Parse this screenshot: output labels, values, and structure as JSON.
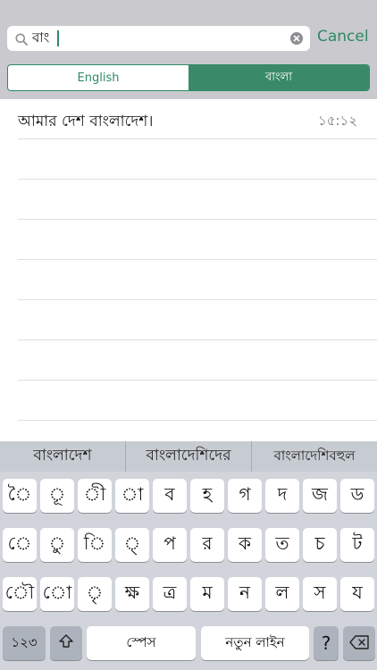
{
  "search": {
    "query": "বাং",
    "cancel_label": "Cancel"
  },
  "segments": [
    {
      "label": "English",
      "selected": false
    },
    {
      "label": "বাংলা",
      "selected": true
    }
  ],
  "results": [
    {
      "text": "আমার দেশ বাংলাদেশ।",
      "time": "১৫:১২"
    }
  ],
  "suggestions": [
    "বাংলাদেশ",
    "বাংলাদেশিদের",
    "বাংলাদেশিবহুল"
  ],
  "keyboard": {
    "row1": [
      "ৈ",
      "ূ",
      "ী",
      "া",
      "ব",
      "হ",
      "গ",
      "দ",
      "জ",
      "ড"
    ],
    "row2": [
      "ে",
      "ু",
      "ি",
      "্",
      "প",
      "র",
      "ক",
      "ত",
      "চ",
      "ট"
    ],
    "row3": [
      "ৌ",
      "ো",
      "ৃ",
      "ক্ষ",
      "ত্র",
      "ম",
      "ন",
      "ল",
      "স",
      "য"
    ],
    "numbers_label": "১২৩",
    "space_label": "স্পেস",
    "newline_label": "নতুন লাইন",
    "question_label": "?"
  },
  "colors": {
    "accent": "#2f8a64",
    "header_bg": "#c9c9ce",
    "keyboard_bg": "#d1d5db"
  }
}
